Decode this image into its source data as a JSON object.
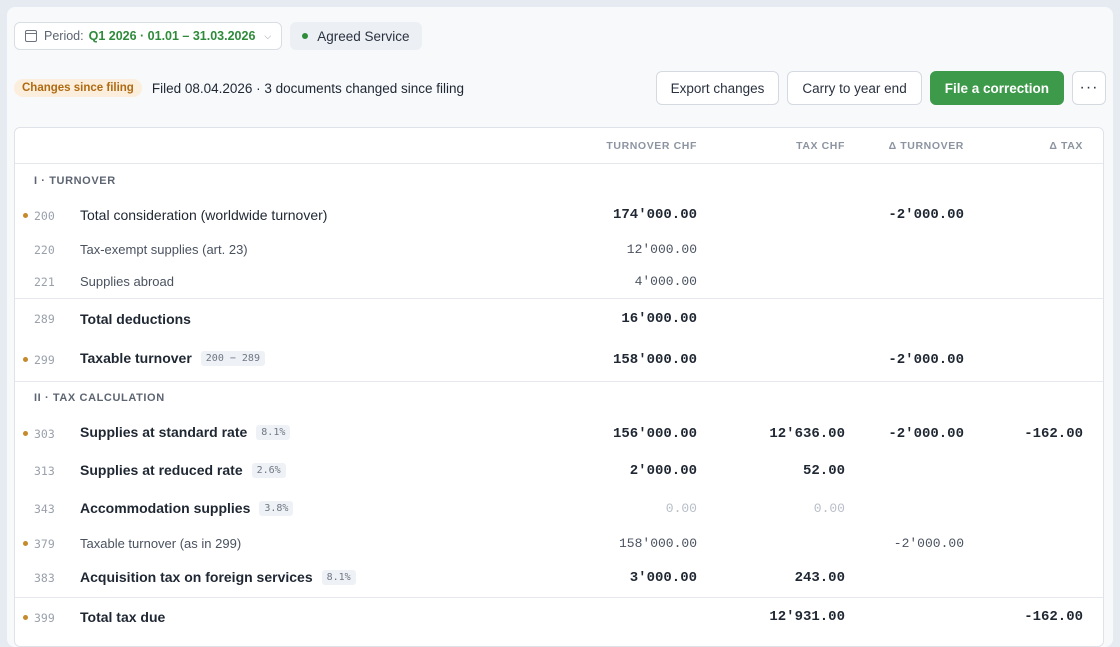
{
  "filter": {
    "period_label": "Period:",
    "period_value": "Q1 2026 · 01.01 – 31.03.2026",
    "service_label": "Agreed Service"
  },
  "status": {
    "badge": "Changes since filing",
    "filed_text": "Filed 08.04.2026 · 3 documents changed since filing"
  },
  "actions": {
    "export": "Export changes",
    "carry": "Carry to year end",
    "correction": "File a correction",
    "more": "···"
  },
  "colors": {
    "accent": "#3e9a4b",
    "period": "#2e8b3a",
    "badge_bg": "#fbeedd",
    "badge_text": "#b06b12",
    "changed_marker": "#c58a2c"
  },
  "columns": {
    "turnover": "TURNOVER CHF",
    "tax": "TAX CHF",
    "delta_turnover": "Δ TURNOVER",
    "delta_tax": "Δ TAX"
  },
  "sections": [
    {
      "title": "I · TURNOVER"
    },
    {
      "title": "II · TAX CALCULATION"
    }
  ],
  "rows": [
    {
      "code": "200",
      "label": "Total consideration (worldwide turnover)",
      "turnover": "174'000.00",
      "tax": "",
      "d_turnover": "-2'000.00",
      "d_tax": "",
      "changed": true
    },
    {
      "code": "220",
      "label": "Tax-exempt supplies (art. 23)",
      "turnover": "12'000.00",
      "tax": "",
      "d_turnover": "",
      "d_tax": "",
      "changed": false
    },
    {
      "code": "221",
      "label": "Supplies abroad",
      "turnover": "4'000.00",
      "tax": "",
      "d_turnover": "",
      "d_tax": "",
      "changed": false
    },
    {
      "code": "289",
      "label": "Total deductions",
      "turnover": "16'000.00",
      "tax": "",
      "d_turnover": "",
      "d_tax": "",
      "changed": false
    },
    {
      "code": "299",
      "label": "Taxable turnover",
      "tag": "200 − 289",
      "turnover": "158'000.00",
      "tax": "",
      "d_turnover": "-2'000.00",
      "d_tax": "",
      "changed": true
    },
    {
      "code": "303",
      "label": "Supplies at standard rate",
      "tag": "8.1%",
      "turnover": "156'000.00",
      "tax": "12'636.00",
      "d_turnover": "-2'000.00",
      "d_tax": "-162.00",
      "changed": true
    },
    {
      "code": "313",
      "label": "Supplies at reduced rate",
      "tag": "2.6%",
      "turnover": "2'000.00",
      "tax": "52.00",
      "d_turnover": "",
      "d_tax": "",
      "changed": false
    },
    {
      "code": "343",
      "label": "Accommodation supplies",
      "tag": "3.8%",
      "turnover": "0.00",
      "tax": "0.00",
      "d_turnover": "",
      "d_tax": "",
      "changed": false
    },
    {
      "code": "379",
      "label": "Taxable turnover (as in 299)",
      "turnover": "158'000.00",
      "tax": "",
      "d_turnover": "-2'000.00",
      "d_tax": "",
      "changed": true
    },
    {
      "code": "383",
      "label": "Acquisition tax on foreign services",
      "tag": "8.1%",
      "turnover": "3'000.00",
      "tax": "243.00",
      "d_turnover": "",
      "d_tax": "",
      "changed": false
    },
    {
      "code": "399",
      "label": "Total tax due",
      "turnover": "",
      "tax": "12'931.00",
      "d_turnover": "",
      "d_tax": "-162.00",
      "changed": true
    }
  ]
}
